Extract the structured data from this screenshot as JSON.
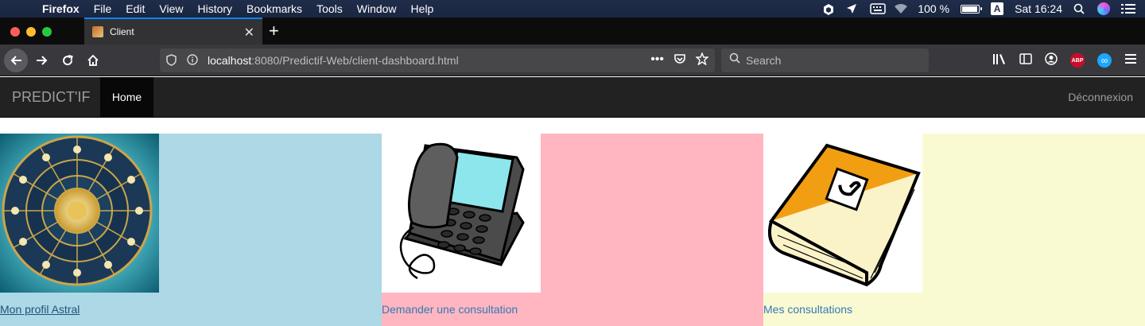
{
  "menubar": {
    "apple": "",
    "app": "Firefox",
    "items": [
      "File",
      "Edit",
      "View",
      "History",
      "Bookmarks",
      "Tools",
      "Window",
      "Help"
    ],
    "battery": "100 %",
    "battery_level": 1.0,
    "input_source": "A",
    "clock": "Sat 16:24"
  },
  "browser": {
    "tab_title": "Client",
    "url_host": "localhost",
    "url_rest": ":8080/Predictif-Web/client-dashboard.html",
    "url_more": "•••",
    "search_placeholder": "Search",
    "abp_label": "ABP"
  },
  "site": {
    "brand": "PREDICT'IF",
    "nav_home": "Home",
    "logout": "Déconnexion"
  },
  "cards": [
    {
      "label": "Mon profil Astral",
      "bg": "#add8e6"
    },
    {
      "label": "Demander une consultation",
      "bg": "#ffb6c1"
    },
    {
      "label": "Mes consultations",
      "bg": "#fafad2"
    }
  ]
}
